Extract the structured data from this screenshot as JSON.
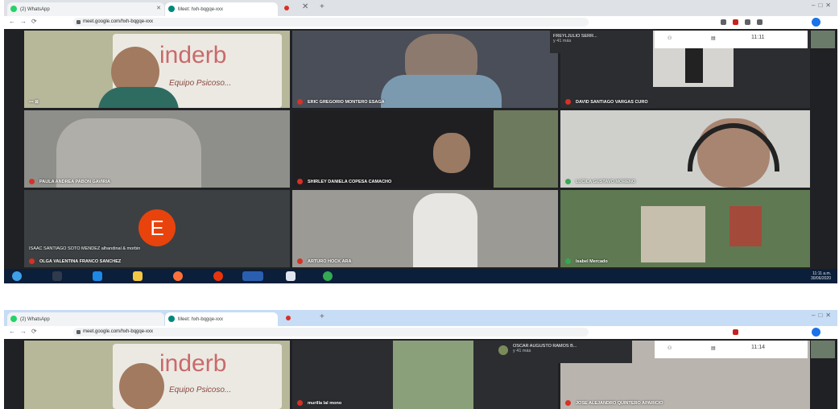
{
  "screens": [
    {
      "tabs": [
        "(2) WhatsApp",
        "Meet: hxh-bqgqe-xxx"
      ],
      "url": "meet.google.com/hxh-bqgqe-xxx",
      "clock": "11:11",
      "top_participant": {
        "name": "FREYLJULIO SERR...",
        "sub": "y 41 más"
      },
      "tiles": [
        {
          "key": "t1",
          "name": "",
          "mic": "off"
        },
        {
          "key": "t2",
          "name": "ERIC GREGORIO MONTERO ESAGA",
          "mic": "off"
        },
        {
          "key": "t3",
          "name": "DAVID SANTIAGO VARGAS CURO",
          "mic": "off"
        },
        {
          "key": "t4",
          "name": "PAULA ANDREA PABON GAVIRIA",
          "mic": "off"
        },
        {
          "key": "t5",
          "name": "SHIRLEY DANIELA COPESA CAMACHO",
          "mic": "off"
        },
        {
          "key": "t6",
          "name": "LUCILA GUSTAVO MORENO",
          "mic": "on"
        },
        {
          "key": "t7",
          "name": "OLGA VALENTINA FRANCO SANCHEZ",
          "mic": "off",
          "avatar_letter": "E",
          "caption": "ISAAC SANTIAGO SOTO MENDEZ alhandinal & morbin"
        },
        {
          "key": "t8",
          "name": "ARTURO HOCK ARA",
          "mic": "off"
        },
        {
          "key": "t9",
          "name": "Isabel Mercado",
          "mic": "on"
        }
      ],
      "tray_time": "11:11 a.m.",
      "tray_date": "30/06/2020"
    },
    {
      "tabs": [
        "(2) WhatsApp",
        "Meet: hxh-bqgqe-xxx"
      ],
      "url": "meet.google.com/hxh-bqgqe-xxx",
      "clock": "11:14",
      "top_participant": {
        "name": "OSCAR AUGUSTO RAMOS B...",
        "sub": "y 41 más"
      },
      "tiles": [
        {
          "key": "s1",
          "name": "",
          "mic": "off"
        },
        {
          "key": "s2",
          "name": "murilla lal mono",
          "mic": "off"
        },
        {
          "key": "s3",
          "name": "JOSE ALEJANDRO QUINTERO APARICIO",
          "mic": "off"
        }
      ]
    }
  ],
  "logo_text": "inderb",
  "banner_text": "Equipo Psicoso...",
  "colors": {
    "meet_bg": "#202124",
    "mic_off": "#d93025",
    "mic_on": "#34a853",
    "avatar": "#e8430c",
    "taskbar": "#0b1e3a"
  }
}
